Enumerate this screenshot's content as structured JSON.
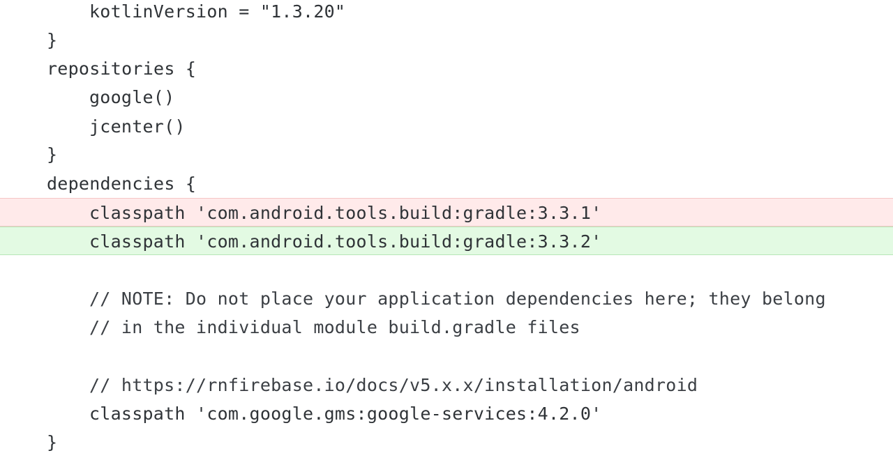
{
  "code_lines": [
    {
      "text": "kotlinVersion = \"1.3.20\"",
      "indent": 1,
      "type": "context"
    },
    {
      "text": "}",
      "indent": 0,
      "type": "context"
    },
    {
      "text": "repositories {",
      "indent": 0,
      "type": "context"
    },
    {
      "text": "google()",
      "indent": 1,
      "type": "context"
    },
    {
      "text": "jcenter()",
      "indent": 1,
      "type": "context"
    },
    {
      "text": "}",
      "indent": 0,
      "type": "context"
    },
    {
      "text": "dependencies {",
      "indent": 0,
      "type": "context"
    },
    {
      "text": "classpath 'com.android.tools.build:gradle:3.3.1'",
      "indent": 1,
      "type": "removed"
    },
    {
      "text": "classpath 'com.android.tools.build:gradle:3.3.2'",
      "indent": 1,
      "type": "added"
    },
    {
      "text": "",
      "indent": 1,
      "type": "context"
    },
    {
      "text": "// NOTE: Do not place your application dependencies here; they belong",
      "indent": 1,
      "type": "context"
    },
    {
      "text": "// in the individual module build.gradle files",
      "indent": 1,
      "type": "context"
    },
    {
      "text": "",
      "indent": 1,
      "type": "context"
    },
    {
      "text": "// https://rnfirebase.io/docs/v5.x.x/installation/android",
      "indent": 1,
      "type": "context"
    },
    {
      "text": "classpath 'com.google.gms:google-services:4.2.0'",
      "indent": 1,
      "type": "context"
    },
    {
      "text": "}",
      "indent": 0,
      "type": "context"
    }
  ],
  "colors": {
    "removed_background": "#ffeaea",
    "added_background": "#e3fae3",
    "text": "#2f3337"
  }
}
